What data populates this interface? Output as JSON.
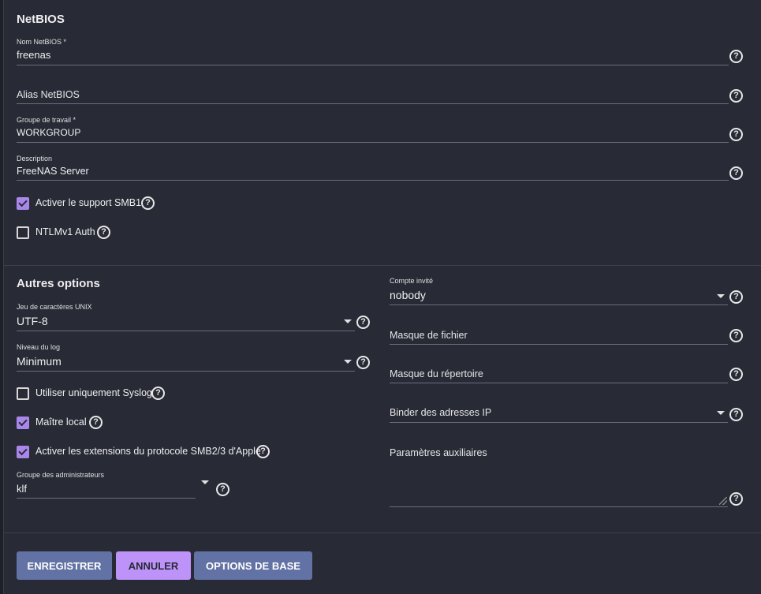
{
  "netbios": {
    "title": "NetBIOS",
    "name": {
      "label": "Nom NetBIOS *",
      "value": "freenas"
    },
    "alias": {
      "placeholder": "Alias NetBIOS"
    },
    "workgroup": {
      "label": "Groupe de travail *",
      "value": "WORKGROUP"
    },
    "description": {
      "label": "Description",
      "value": "FreeNAS Server"
    },
    "smb1": {
      "label": "Activer le support SMB1",
      "checked": true
    },
    "ntlmv1": {
      "label": "NTLMv1 Auth",
      "checked": false
    }
  },
  "other": {
    "title": "Autres options",
    "charset": {
      "label": "Jeu de caractères UNIX",
      "value": "UTF-8"
    },
    "loglevel": {
      "label": "Niveau du log",
      "value": "Minimum"
    },
    "syslog": {
      "label": "Utiliser uniquement Syslog",
      "checked": false
    },
    "local_master": {
      "label": "Maître local",
      "checked": true
    },
    "apple_ext": {
      "label": "Activer les extensions du protocole SMB2/3 d'Apple",
      "checked": true
    },
    "admin_group": {
      "label": "Groupe des administrateurs",
      "value": "klf"
    },
    "guest": {
      "label": "Compte invité",
      "value": "nobody"
    },
    "filemask": {
      "placeholder": "Masque de fichier"
    },
    "dirmask": {
      "placeholder": "Masque du répertoire"
    },
    "bind_ip": {
      "placeholder": "Binder des adresses IP"
    },
    "aux": {
      "placeholder": "Paramètres auxiliaires"
    }
  },
  "help_glyph": "?",
  "buttons": {
    "save": "ENREGISTRER",
    "cancel": "ANNULER",
    "basic": "OPTIONS DE BASE"
  },
  "colors": {
    "background": "#282a36",
    "primary": "#6272a4",
    "accent": "#bd93f9",
    "checkbox": "#a987ea"
  }
}
